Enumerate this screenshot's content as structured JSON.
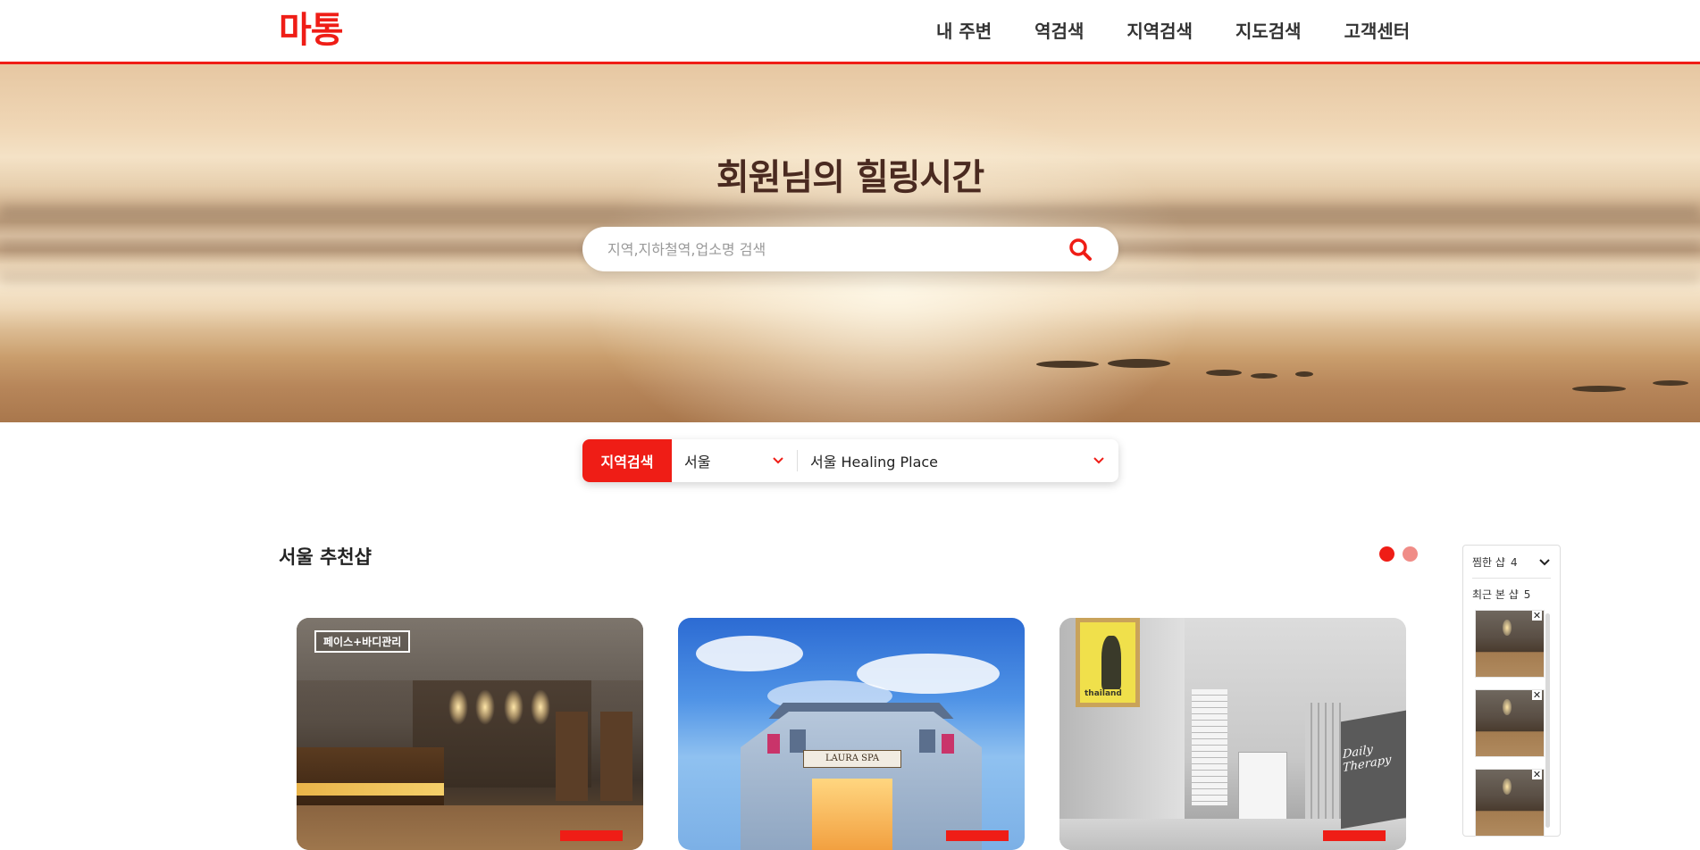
{
  "header": {
    "logo": "마통",
    "nav": [
      "내 주변",
      "역검색",
      "지역검색",
      "지도검색",
      "고객센터"
    ]
  },
  "hero": {
    "title": "회원님의 힐링시간",
    "search_placeholder": "지역,지하철역,업소명 검색"
  },
  "region_search": {
    "label": "지역검색",
    "city": "서울",
    "place": "서울 Healing Place"
  },
  "recommended": {
    "title": "서울 추천샵",
    "cards": [
      {
        "tag": "페이스+바디관리"
      },
      {
        "sign": "LAURA SPA"
      },
      {
        "poster": "thailand",
        "sign": "Daily Therapy"
      }
    ]
  },
  "side_panel": {
    "liked_label": "찜한 샵",
    "liked_count": "4",
    "recent_label": "최근 본 샵",
    "recent_count": "5",
    "close_symbol": "✕"
  },
  "colors": {
    "accent": "#ef1d16",
    "title_brown": "#4a2a20"
  }
}
